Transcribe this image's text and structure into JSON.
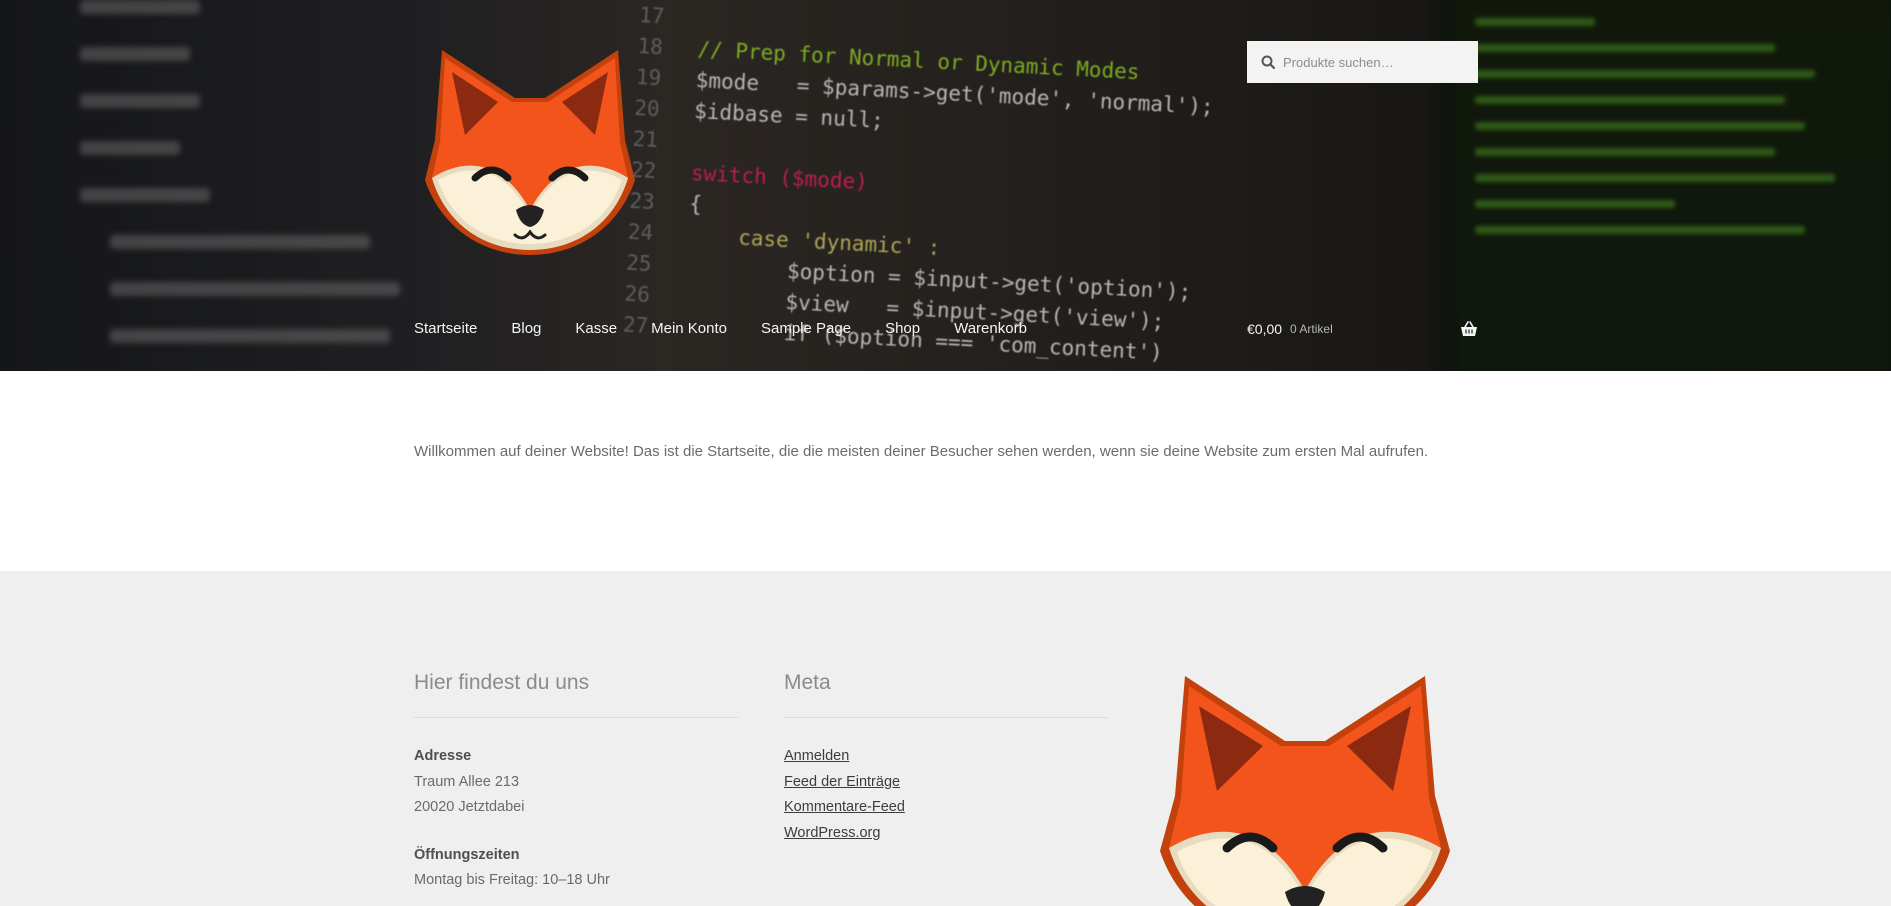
{
  "header": {
    "search": {
      "placeholder": "Produkte suchen…"
    },
    "nav": [
      {
        "label": "Startseite"
      },
      {
        "label": "Blog"
      },
      {
        "label": "Kasse"
      },
      {
        "label": "Mein Konto"
      },
      {
        "label": "Sample Page"
      },
      {
        "label": "Shop"
      },
      {
        "label": "Warenkorb"
      }
    ],
    "cart": {
      "amount": "€0,00",
      "count": "0 Artikel"
    },
    "code_background": [
      {
        "num": "17",
        "text": ""
      },
      {
        "num": "18",
        "text": "// Prep for Normal or Dynamic Modes"
      },
      {
        "num": "19",
        "text": "$mode   = $params->get('mode', 'normal');"
      },
      {
        "num": "20",
        "text": "$idbase = null;"
      },
      {
        "num": "21",
        "text": ""
      },
      {
        "num": "22",
        "text": "switch ($mode)"
      },
      {
        "num": "23",
        "text": "{"
      },
      {
        "num": "24",
        "text": "    case 'dynamic' :"
      },
      {
        "num": "25",
        "text": "        $option = $input->get('option');"
      },
      {
        "num": "26",
        "text": "        $view   = $input->get('view');"
      },
      {
        "num": "27",
        "text": "        if ($option === 'com_content')"
      }
    ]
  },
  "main": {
    "welcome_text": "Willkommen auf deiner Website! Das ist die Startseite, die die meisten deiner Besucher sehen werden, wenn sie deine Website zum ersten Mal aufrufen."
  },
  "footer": {
    "widget1": {
      "title": "Hier findest du uns",
      "address_label": "Adresse",
      "address_line1": "Traum Allee 213",
      "address_line2": "20020 Jetztdabei",
      "hours_label": "Öffnungszeiten",
      "hours_line1": "Montag bis Freitag: 10–18 Uhr"
    },
    "widget2": {
      "title": "Meta",
      "links": [
        {
          "label": "Anmelden"
        },
        {
          "label": "Feed der Einträge"
        },
        {
          "label": "Kommentare-Feed"
        },
        {
          "label": "WordPress.org"
        }
      ]
    }
  },
  "colors": {
    "fox_orange": "#f2541b",
    "fox_dark": "#8b2a10",
    "fox_cream": "#fbf1d8",
    "page_bg": "#efefef",
    "main_bg": "#ffffff"
  }
}
